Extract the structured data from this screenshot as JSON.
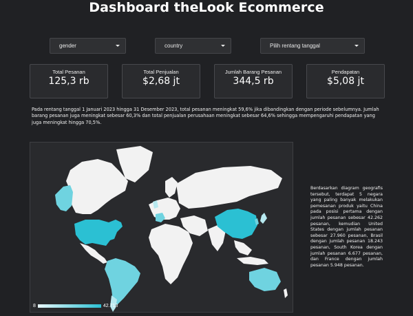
{
  "header": {
    "title": "Dashboard theLook Ecommerce"
  },
  "filters": [
    {
      "label": "gender"
    },
    {
      "label": "country"
    },
    {
      "label": "Pilih rentang tanggal"
    }
  ],
  "kpis": [
    {
      "label": "Total Pesanan",
      "value": "125,3 rb"
    },
    {
      "label": "Total Penjualan",
      "value": "$2,68 jt"
    },
    {
      "label": "Jumlah Barang Pesanan",
      "value": "344,5 rb"
    },
    {
      "label": "Pendapatan",
      "value": "$5,08 jt"
    }
  ],
  "summary": "Pada rentang tanggal 1 Januari 2023 hingga 31 Desember 2023, total pesanan meningkat 59,6% jika dibandingkan dengan periode sebelumnya. Jumlah barang pesanan juga meningkat sebesar 60,3% dan total penjualan perusahaan meningkat sebesar 64,6% sehingga mempengaruhi pendapatan yang juga meningkat hingga 70,5%.",
  "map": {
    "legend_min": "8",
    "legend_max": "42.713",
    "colors": {
      "land": "#f2f2f2",
      "high": "#2bc0d3",
      "mid": "#6fd3e0",
      "low": "#b7e9f0",
      "ocean": "#292a2d"
    }
  },
  "insight": "Berdasarkan diagram geografis tersebut, terdapat 5 negara yang paling banyak melakukan pemesanan produk yaitu China pada posisi pertama dengan jumlah pesanan sebesar 42.262 pesanan, kemudian United States dengan jumlah pesanan sebesar 27.960 pesanan, Brasil dengan jumlah pesanan 18.243 pesanan, South Korea dengan jumlah pesanan 6.677 pesanan, dan France dengan jumlah pesanan 5.948 pesanan."
}
